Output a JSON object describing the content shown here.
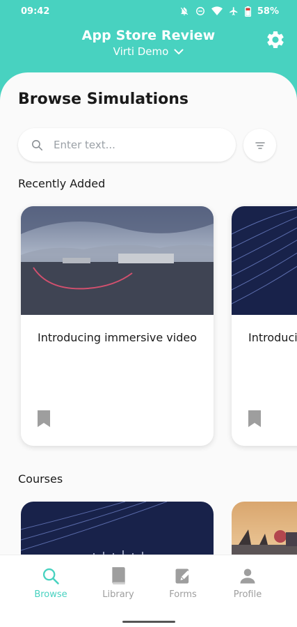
{
  "status_bar": {
    "time": "09:42",
    "battery": "58%",
    "icons": [
      "notifications-off-icon",
      "do-not-disturb-icon",
      "wifi-icon",
      "airplane-mode-icon",
      "battery-icon"
    ]
  },
  "header": {
    "title": "App Store Review",
    "org_selector": "Virti Demo",
    "settings_icon": "gear-icon"
  },
  "page": {
    "title": "Browse Simulations"
  },
  "search": {
    "placeholder": "Enter text...",
    "value": ""
  },
  "recently_added": {
    "label": "Recently Added",
    "cards": [
      {
        "title": "Introducing immersive video",
        "thumbnail": "360-panorama-harbour"
      },
      {
        "title": "Introducing immersive video",
        "thumbnail": "navy-line-pattern"
      }
    ]
  },
  "courses": {
    "label": "Courses",
    "cards": [
      {
        "thumbnail": "navy-line-pattern"
      },
      {
        "thumbnail": "harbour-sunset-photo"
      }
    ]
  },
  "bottom_nav": {
    "items": [
      {
        "label": "Browse",
        "icon": "search-icon",
        "active": true
      },
      {
        "label": "Library",
        "icon": "book-icon",
        "active": false
      },
      {
        "label": "Forms",
        "icon": "edit-form-icon",
        "active": false
      },
      {
        "label": "Profile",
        "icon": "person-icon",
        "active": false
      }
    ]
  },
  "colors": {
    "accent": "#48d2c0",
    "navy": "#18224a",
    "inactive": "#9e9e9e"
  }
}
